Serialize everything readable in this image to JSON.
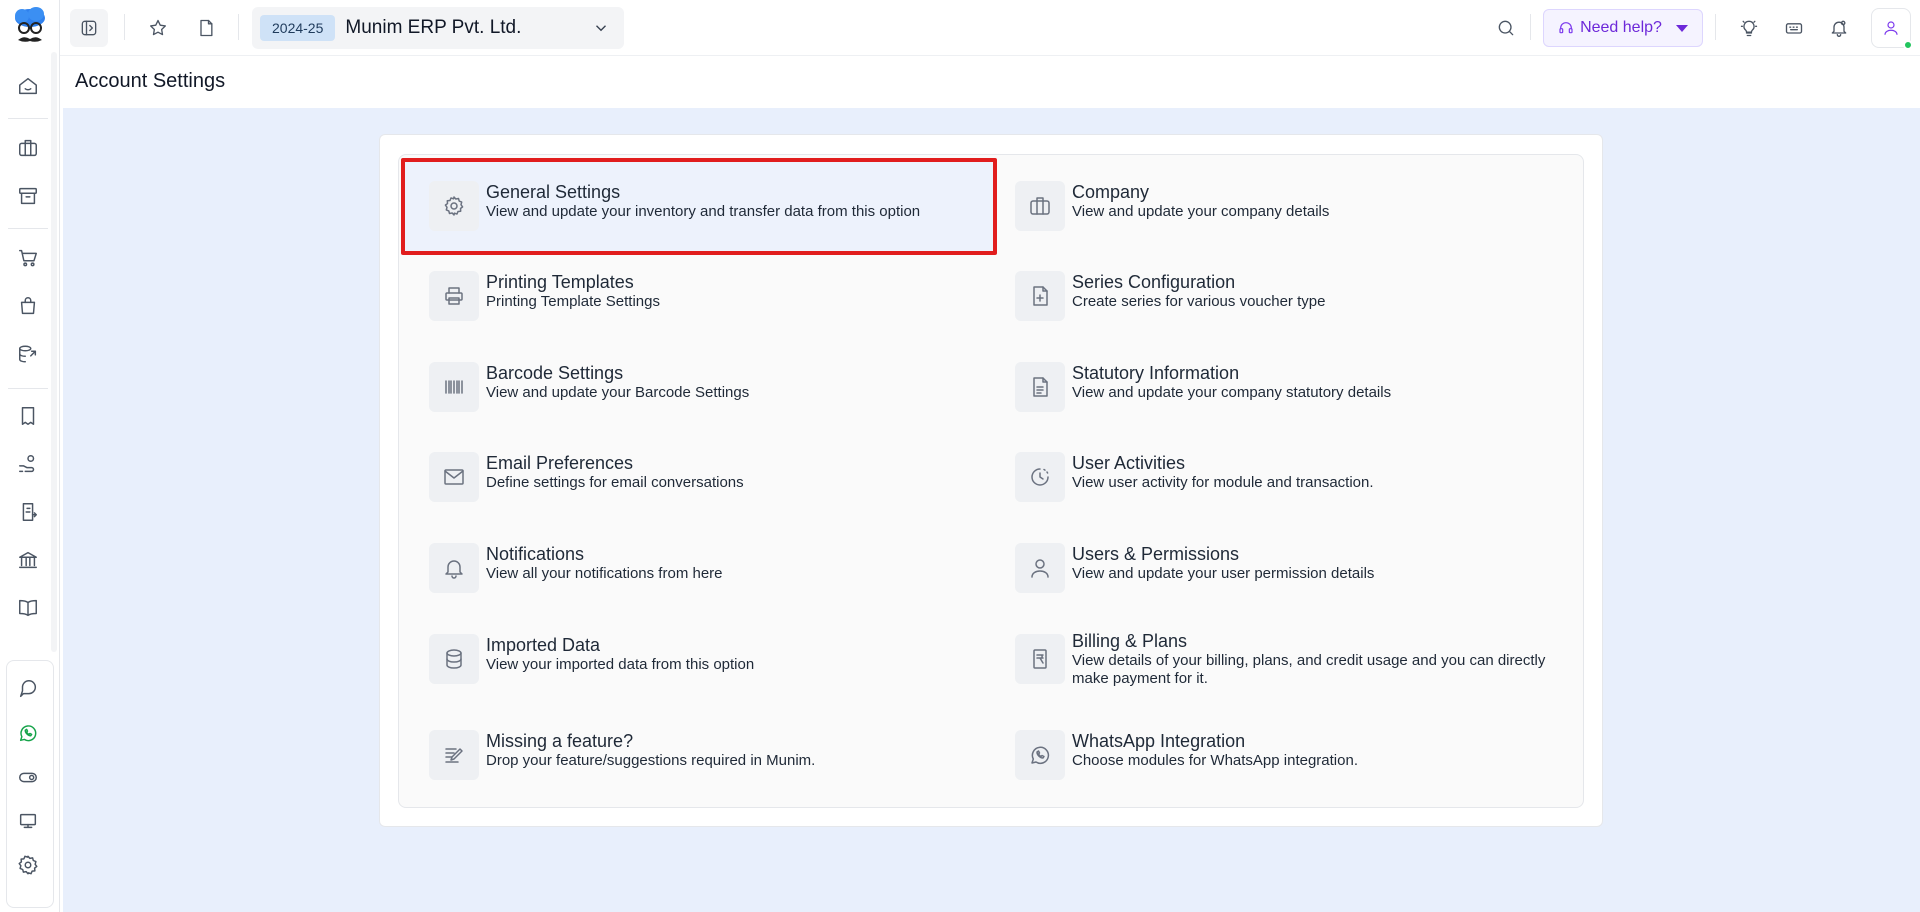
{
  "topbar": {
    "financial_year": "2024-25",
    "company_name": "Munim ERP Pvt. Ltd.",
    "help_label": "Need help?"
  },
  "page": {
    "title": "Account Settings"
  },
  "settings": {
    "left": [
      {
        "title": "General Settings",
        "desc": "View and update your inventory and transfer data from this option",
        "icon": "gear-icon"
      },
      {
        "title": "Printing Templates",
        "desc": "Printing Template Settings",
        "icon": "printer-icon"
      },
      {
        "title": "Barcode Settings",
        "desc": "View and update your Barcode Settings",
        "icon": "barcode-icon"
      },
      {
        "title": "Email Preferences",
        "desc": "Define settings for email conversations",
        "icon": "mail-icon"
      },
      {
        "title": "Notifications",
        "desc": "View all your notifications from here",
        "icon": "bell-icon"
      },
      {
        "title": "Imported Data",
        "desc": "View your imported data from this option",
        "icon": "database-icon"
      },
      {
        "title": "Missing a feature?",
        "desc": "Drop your feature/suggestions required in Munim.",
        "icon": "edit-note-icon"
      }
    ],
    "right": [
      {
        "title": "Company",
        "desc": "View and update your company details",
        "icon": "briefcase-icon"
      },
      {
        "title": "Series Configuration",
        "desc": "Create series for various voucher type",
        "icon": "file-plus-icon"
      },
      {
        "title": "Statutory Information",
        "desc": "View and update your company statutory details",
        "icon": "document-icon"
      },
      {
        "title": "User Activities",
        "desc": "View user activity for module and transaction.",
        "icon": "clock-icon"
      },
      {
        "title": "Users & Permissions",
        "desc": "View and update your user permission details",
        "icon": "user-icon"
      },
      {
        "title": "Billing & Plans",
        "desc": "View details of your billing, plans, and credit usage and you can directly make payment for it.",
        "icon": "rupee-receipt-icon"
      },
      {
        "title": "WhatsApp Integration",
        "desc": "Choose modules for WhatsApp integration.",
        "icon": "whatsapp-icon"
      }
    ]
  },
  "colors": {
    "highlight": "#e11d1d",
    "accent": "#7c3aed",
    "whatsapp": "#16a34a",
    "page_bg": "#e8effc"
  }
}
